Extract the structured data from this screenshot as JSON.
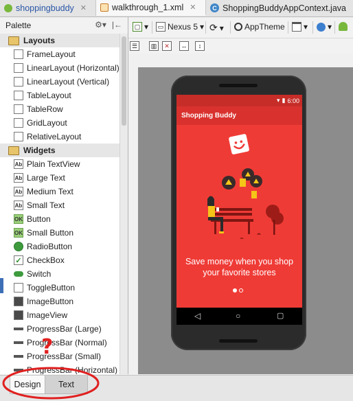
{
  "tabs": [
    {
      "label": "shoppingbuddy",
      "icon": "android-module-icon",
      "active": false
    },
    {
      "label": "walkthrough_1.xml",
      "icon": "layout-xml-icon",
      "active": true
    },
    {
      "label": "ShoppingBuddyAppContext.java",
      "icon": "java-class-icon",
      "active": false
    }
  ],
  "palette": {
    "title": "Palette",
    "categories": [
      {
        "label": "Layouts",
        "items": [
          {
            "label": "FrameLayout",
            "icon": "frame-layout-icon"
          },
          {
            "label": "LinearLayout (Horizontal)",
            "icon": "linear-horizontal-icon"
          },
          {
            "label": "LinearLayout (Vertical)",
            "icon": "linear-vertical-icon"
          },
          {
            "label": "TableLayout",
            "icon": "table-layout-icon"
          },
          {
            "label": "TableRow",
            "icon": "table-row-icon"
          },
          {
            "label": "GridLayout",
            "icon": "grid-layout-icon"
          },
          {
            "label": "RelativeLayout",
            "icon": "relative-layout-icon"
          }
        ]
      },
      {
        "label": "Widgets",
        "items": [
          {
            "label": "Plain TextView",
            "icon": "textview-icon",
            "glyph": "Ab"
          },
          {
            "label": "Large Text",
            "icon": "large-text-icon",
            "glyph": "Ab"
          },
          {
            "label": "Medium Text",
            "icon": "medium-text-icon",
            "glyph": "Ab"
          },
          {
            "label": "Small Text",
            "icon": "small-text-icon",
            "glyph": "Ab"
          },
          {
            "label": "Button",
            "icon": "button-icon",
            "glyph": "OK"
          },
          {
            "label": "Small Button",
            "icon": "small-button-icon",
            "glyph": "OK"
          },
          {
            "label": "RadioButton",
            "icon": "radio-icon"
          },
          {
            "label": "CheckBox",
            "icon": "checkbox-icon"
          },
          {
            "label": "Switch",
            "icon": "switch-icon"
          },
          {
            "label": "ToggleButton",
            "icon": "toggle-icon"
          },
          {
            "label": "ImageButton",
            "icon": "image-button-icon"
          },
          {
            "label": "ImageView",
            "icon": "imageview-icon"
          },
          {
            "label": "ProgressBar (Large)",
            "icon": "progress-large-icon"
          },
          {
            "label": "ProgressBar (Normal)",
            "icon": "progress-normal-icon"
          },
          {
            "label": "ProgressBar (Small)",
            "icon": "progress-small-icon"
          },
          {
            "label": "ProgressBar (Horizontal)",
            "icon": "progress-horizontal-icon"
          }
        ]
      }
    ]
  },
  "toolbar": {
    "device": "Nexus 5",
    "theme": "AppTheme"
  },
  "preview": {
    "status_time": "6:00",
    "app_title": "Shopping Buddy",
    "slogan_line1": "Save money when you shop",
    "slogan_line2": "your favorite stores",
    "page_count": 2,
    "current_page": 1
  },
  "bottom_tabs": {
    "design": "Design",
    "text": "Text"
  },
  "annotation": {
    "mark": "?",
    "color": "#e02020"
  },
  "colors": {
    "app_red": "#ef3b36",
    "appbar_red": "#d9322e",
    "status_red": "#c62d28"
  }
}
